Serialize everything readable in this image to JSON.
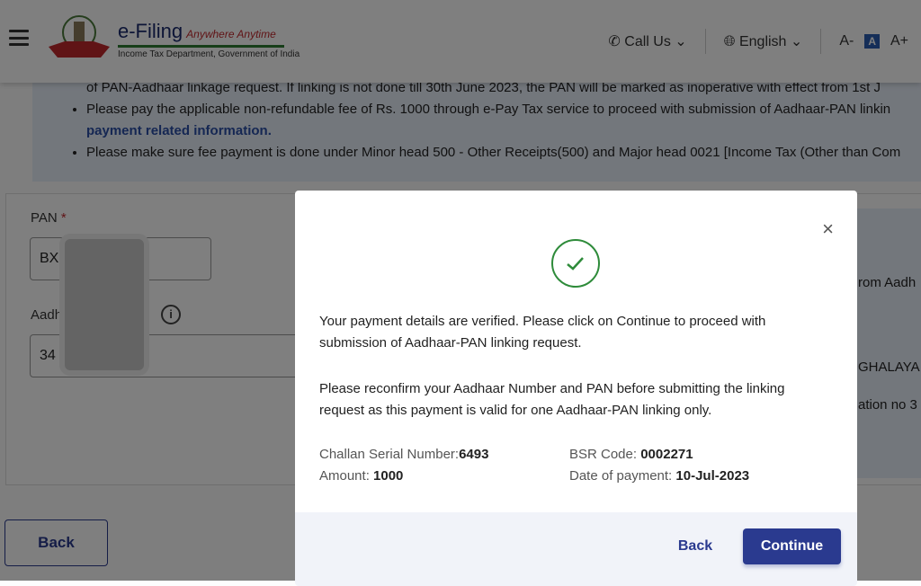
{
  "header": {
    "brand_title": "e-Filing",
    "brand_tagline": "Anywhere Anytime",
    "brand_subtitle": "Income Tax Department, Government of India",
    "call_us": "Call Us",
    "language": "English",
    "font_decrease": "A-",
    "font_normal": "A",
    "font_increase": "A+"
  },
  "info": {
    "line0": "of PAN-Aadhaar linkage request. If linking is not done till 30th June 2023, the PAN will be marked as inoperative with effect from 1st J",
    "bullet1": "Please pay the applicable non-refundable fee of Rs. 1000 through e-Pay Tax service to proceed with submission of Aadhaar-PAN linkin",
    "bullet1_link": "payment related information.",
    "bullet2": "Please make sure fee payment is done under Minor head 500 - Other Receipts(500) and Major head 0021 [Income Tax (Other than Com"
  },
  "form": {
    "pan_label": "PAN",
    "required_mark": "*",
    "pan_value": "BX",
    "aadhaar_label": "Aadh",
    "aadhaar_value": "34",
    "back": "Back"
  },
  "side": {
    "t1": "rom Aadh",
    "t2": "GHALAYA",
    "t3": "ation no 3"
  },
  "modal": {
    "message1": "Your payment details are verified. Please click on Continue to proceed with submission of Aadhaar-PAN linking request.",
    "message2": "Please reconfirm your Aadhaar Number and PAN before submitting the linking request as this payment is valid for one Aadhaar-PAN linking only.",
    "challan_label": "Challan Serial Number:",
    "challan_value": "6493",
    "amount_label": "Amount: ",
    "amount_value": "1000",
    "bsr_label": "BSR Code: ",
    "bsr_value": "0002271",
    "date_label": "Date of payment: ",
    "date_value": "10-Jul-2023",
    "close": "×",
    "back": "Back",
    "continue": "Continue"
  },
  "colors": {
    "primary": "#2a3a8f",
    "success": "#2e8b3a",
    "link": "#2a4fa6"
  }
}
